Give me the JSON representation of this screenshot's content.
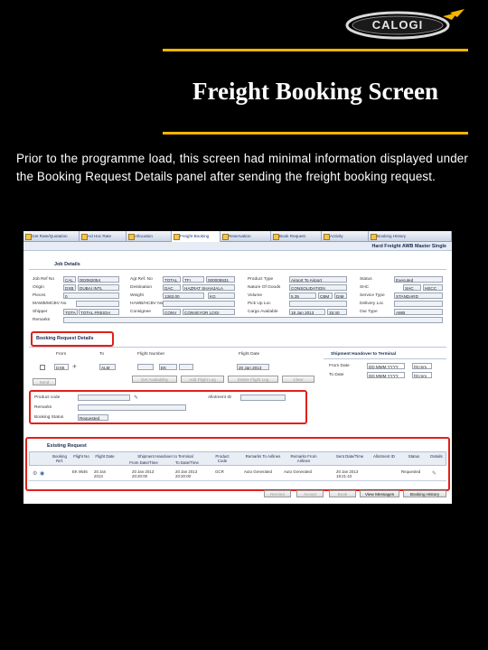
{
  "slide": {
    "logo_text": "CALOGI",
    "title": "Freight Booking Screen",
    "description": "Prior to the programme load, this screen had minimal information displayed under the Booking Request Details panel after sending the freight booking request.",
    "colors": {
      "background": "#000000",
      "rule": "#f4b400",
      "highlight": "#e0201b"
    }
  },
  "app": {
    "tabs": [
      "Get Rate/Quotation",
      "Ad Hoc Rate",
      "Allocation",
      "Freight Booking",
      "Reservation",
      "Book Request",
      "Activity",
      "Booking History"
    ],
    "header_title": "Hard Freight AWB Master Single",
    "job_details": {
      "section_label": "Job Details",
      "job_ref_label": "Job Ref No",
      "job_ref_prefix": "CAL",
      "job_ref_value": "002062054",
      "origin_label": "Origin",
      "origin_code": "DXB",
      "origin_name": "DUBAI INTL",
      "pieces_label": "Pieces",
      "pieces_value": "0",
      "mawb_label": "MAWB/MCBV No",
      "shipper_label": "Shipper",
      "shipper_code": "TOTA",
      "shipper_name": "TOTAL FREIGH",
      "remarks_label": "Remarks",
      "agt_ref_label": "Agt Ref. No",
      "agt_ref_code": "TOTAL",
      "agt_ref_mid": "TFI",
      "agt_ref_value": "000005531",
      "destination_label": "Destination",
      "destination_code": "DAC",
      "destination_name": "HAZRAT SHAHJALA",
      "weight_label": "Weight",
      "weight_value": "1363.00",
      "weight_unit": "KG",
      "hawb_label": "HAWB/HCBV No",
      "consignee_label": "Consignee",
      "consignee_code": "CONV",
      "consignee_name": "CONVEYOR LOGI",
      "product_type_label": "Product Type",
      "product_type_value": "Airport To Airport",
      "nature_label": "Nature Of Goods",
      "nature_value": "CONSOLIDATION",
      "volume_label": "Volume",
      "volume_value": "5.35",
      "volume_unit1": "CBM",
      "volume_unit2": "DIM",
      "pickup_label": "Pick Up Loc",
      "cargo_label": "Cargo Available",
      "cargo_date": "19 Jan 2013",
      "cargo_time": "15:40",
      "status_label": "Status",
      "status_value": "Executed",
      "shc_label": "SHC",
      "shc_value1": "SHC",
      "shc_value2": "HECC",
      "service_label": "Service Type",
      "service_value": "STANDARD",
      "delivery_label": "Delivery Loc",
      "our_type_label": "Our Type",
      "our_type_value": "AWB"
    },
    "booking_request": {
      "section_label": "Booking Request Details",
      "from_label": "From",
      "to_label": "To",
      "flight_label": "Flight Number",
      "date_label": "Flight Date",
      "from_value": "DXB",
      "to_value": "ALM",
      "flight_value1": "",
      "flight_value2": "EK",
      "flight_value3": "",
      "date_value": "20 Jan 2013",
      "send_label": "Send",
      "btn_availability": "Get Availability",
      "btn_add": "Add Flight Leg",
      "btn_delete": "Delete Flight Leg",
      "btn_clear": "Clear"
    },
    "handover": {
      "section_label": "Shipment Handover to Terminal",
      "from_date_label": "From Date",
      "from_date_value": "DD MMM YYYY",
      "from_time": "hh:mm",
      "to_date_label": "To Date",
      "to_date_value": "DD MMM YYYY",
      "to_time": "hh:mm"
    },
    "extra": {
      "product_code_label": "Product code",
      "allotment_label": "Allotment ID",
      "remarks_label": "Remarks",
      "booking_status_label": "Booking Status",
      "booking_status_value": "Requested"
    },
    "existing_request": {
      "section_label": "Existing Request",
      "headers": [
        "Booking Ref.",
        "Flight No",
        "Flight Date",
        "Shipment Handover to Terminal",
        "From Date/Time",
        "To Date/Time",
        "Product Code",
        "Remarks To Airlines",
        "Remarks From Airlines",
        "Sent Date/Time",
        "Allotment ID",
        "Status",
        "Details"
      ],
      "row": {
        "flight_no": "EK 9546",
        "flight_date": "20 Jan 2013",
        "from_dt": "20 Jan 2013 20:20:00",
        "to_dt": "20 Jan 2013 20:20:00",
        "product_code": "GCR",
        "remarks_to": "Auto Generated",
        "remarks_from": "Auto Generated",
        "sent_dt": "20 Jan 2013 19:21:43",
        "status": "Requested"
      }
    },
    "footer_buttons": [
      "Remind",
      "Accept",
      "Book",
      "View Messages",
      "Booking History"
    ]
  }
}
